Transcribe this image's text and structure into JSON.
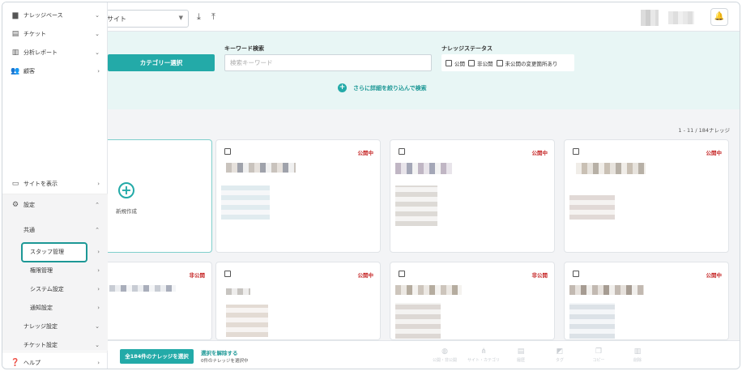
{
  "topbar": {
    "site_select_value": "サイト",
    "download_icon": "download-icon",
    "upload_icon": "upload-icon",
    "bell_icon": "bell-icon"
  },
  "sidebar": {
    "items": [
      {
        "icon": "document-icon",
        "label": "ナレッジベース"
      },
      {
        "icon": "ticket-icon",
        "label": "チケット"
      },
      {
        "icon": "chart-icon",
        "label": "分析レポート"
      },
      {
        "icon": "people-icon",
        "label": "顧客"
      },
      {
        "icon": "monitor-icon",
        "label": "サイトを表示"
      },
      {
        "icon": "gear-icon",
        "label": "設定"
      },
      {
        "icon": "",
        "label": "共通"
      },
      {
        "icon": "",
        "label": "スタッフ管理"
      },
      {
        "icon": "",
        "label": "権限管理"
      },
      {
        "icon": "",
        "label": "システム設定"
      },
      {
        "icon": "",
        "label": "通知設定"
      },
      {
        "icon": "",
        "label": "ナレッジ設定"
      },
      {
        "icon": "",
        "label": "チケット設定"
      },
      {
        "icon": "help-icon",
        "label": "ヘルプ"
      }
    ]
  },
  "filter": {
    "category_button": "カテゴリー選択",
    "keyword_label": "キーワード検索",
    "keyword_placeholder": "検索キーワード",
    "status_label": "ナレッジステータス",
    "status_options": [
      "公開",
      "非公開",
      "未公開の変更箇所あり"
    ],
    "more_search": "さらに詳細を絞り込んで検索"
  },
  "list": {
    "count": "1 - 11 / 184ナレッジ",
    "new_label": "新規作成",
    "cards_row1": [
      {
        "status": "公開中"
      },
      {
        "status": "公開中"
      },
      {
        "status": "公開中"
      }
    ],
    "cards_row2": [
      {
        "status": "非公開"
      },
      {
        "status": "公開中"
      },
      {
        "status": "非公開"
      },
      {
        "status": "公開中"
      }
    ]
  },
  "bottom": {
    "select_all": "全184件のナレッジを選択",
    "unselect": "選択を解除する",
    "selected_note": "0件のナレッジを選択中",
    "actions": [
      {
        "icon": "globe-icon",
        "label": "公開・非公開"
      },
      {
        "icon": "sitemap-icon",
        "label": "サイト・カテゴリ"
      },
      {
        "icon": "file-icon",
        "label": "履歴"
      },
      {
        "icon": "tag-icon",
        "label": "タグ"
      },
      {
        "icon": "copy-icon",
        "label": "コピー"
      },
      {
        "icon": "trash-icon",
        "label": "削除"
      }
    ]
  },
  "colors": {
    "accent": "#23aaa8",
    "status_red": "#c62828",
    "highlight": "#1d9896"
  }
}
